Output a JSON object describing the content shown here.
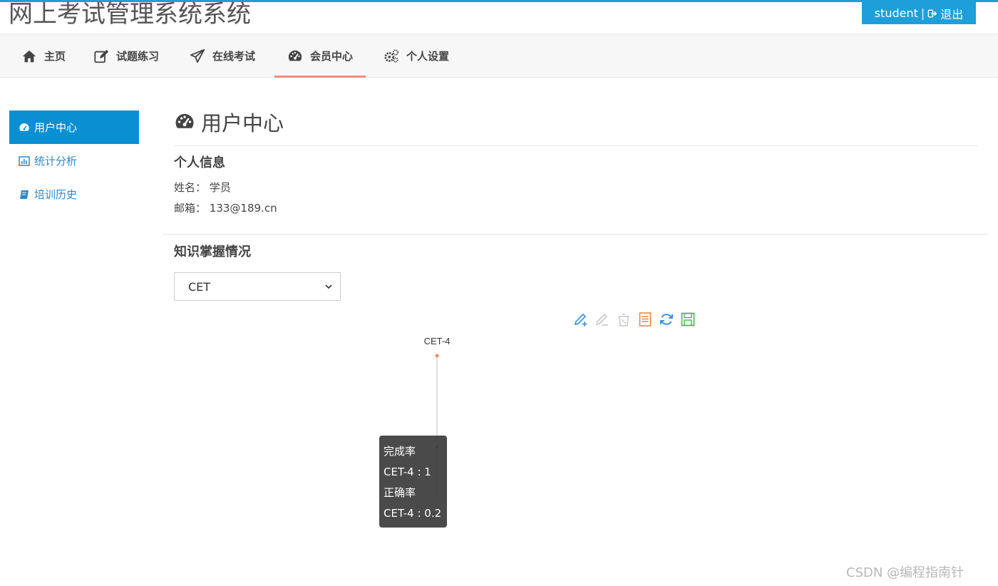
{
  "header": {
    "site_title": "网上考试管理系统系统",
    "user": {
      "name": "student",
      "separator": "|",
      "logout_label": "退出"
    }
  },
  "nav": {
    "items": [
      {
        "label": "主页",
        "icon": "home-icon"
      },
      {
        "label": "试题练习",
        "icon": "edit-icon"
      },
      {
        "label": "在线考试",
        "icon": "paper-plane-icon"
      },
      {
        "label": "会员中心",
        "icon": "dashboard-icon",
        "active": true
      },
      {
        "label": "个人设置",
        "icon": "gears-icon"
      }
    ]
  },
  "sidebar": {
    "items": [
      {
        "label": "用户中心",
        "icon": "dashboard-icon",
        "active": true
      },
      {
        "label": "统计分析",
        "icon": "bar-chart-icon"
      },
      {
        "label": "培训历史",
        "icon": "book-icon"
      }
    ]
  },
  "main": {
    "page_title": "用户中心",
    "personal_info": {
      "title": "个人信息",
      "name_label": "姓名：",
      "name_value": "学员",
      "email_label": "邮箱：",
      "email_value": "133@189.cn"
    },
    "knowledge": {
      "title": "知识掌握情况",
      "select_value": "CET"
    }
  },
  "toolbox": [
    "pencil-plus-icon",
    "pencil-icon",
    "trash-icon",
    "document-icon",
    "refresh-icon",
    "save-icon"
  ],
  "colors": {
    "accent": "#1e9fd9",
    "sidebar_active": "#0a8fd3",
    "nav_underline": "#f08a82",
    "point": "#f08a5a"
  },
  "chart_data": {
    "type": "line",
    "categories": [
      "CET-4"
    ],
    "series": [
      {
        "name": "完成率",
        "values": [
          1
        ]
      },
      {
        "name": "正确率",
        "values": [
          0.2
        ]
      }
    ]
  },
  "tooltip": {
    "lines": [
      "完成率",
      "CET-4 : 1",
      "正确率",
      "CET-4 : 0.2"
    ]
  },
  "watermark": "CSDN @编程指南针"
}
